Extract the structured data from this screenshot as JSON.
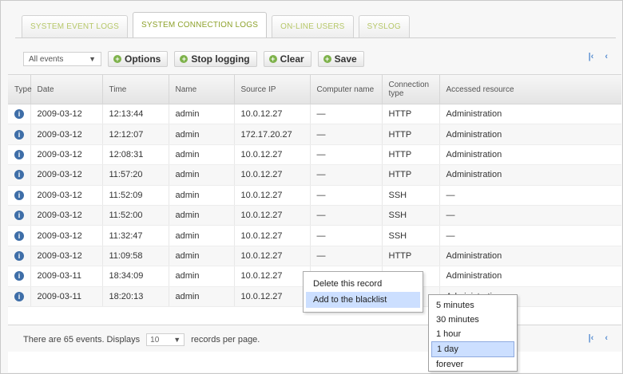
{
  "tabs": [
    {
      "label": "SYSTEM EVENT LOGS",
      "active": false
    },
    {
      "label": "SYSTEM CONNECTION LOGS",
      "active": true
    },
    {
      "label": "ON-LINE USERS",
      "active": false
    },
    {
      "label": "SYSLOG",
      "active": false
    }
  ],
  "toolbar": {
    "filter_value": "All events",
    "options_label": "Options",
    "stop_logging_label": "Stop logging",
    "clear_label": "Clear",
    "save_label": "Save"
  },
  "pager": {
    "first": "|‹",
    "prev": "‹"
  },
  "table": {
    "headers": [
      "Type",
      "Date",
      "Time",
      "Name",
      "Source IP",
      "Computer name",
      "Connection type",
      "Accessed resource"
    ],
    "rows": [
      [
        "i",
        "2009-03-12",
        "12:13:44",
        "admin",
        "10.0.12.27",
        "—",
        "HTTP",
        "Administration"
      ],
      [
        "i",
        "2009-03-12",
        "12:12:07",
        "admin",
        "172.17.20.27",
        "—",
        "HTTP",
        "Administration"
      ],
      [
        "i",
        "2009-03-12",
        "12:08:31",
        "admin",
        "10.0.12.27",
        "—",
        "HTTP",
        "Administration"
      ],
      [
        "i",
        "2009-03-12",
        "11:57:20",
        "admin",
        "10.0.12.27",
        "—",
        "HTTP",
        "Administration"
      ],
      [
        "i",
        "2009-03-12",
        "11:52:09",
        "admin",
        "10.0.12.27",
        "—",
        "SSH",
        "—"
      ],
      [
        "i",
        "2009-03-12",
        "11:52:00",
        "admin",
        "10.0.12.27",
        "—",
        "SSH",
        "—"
      ],
      [
        "i",
        "2009-03-12",
        "11:32:47",
        "admin",
        "10.0.12.27",
        "—",
        "SSH",
        "—"
      ],
      [
        "i",
        "2009-03-12",
        "11:09:58",
        "admin",
        "10.0.12.27",
        "—",
        "HTTP",
        "Administration"
      ],
      [
        "i",
        "2009-03-11",
        "18:34:09",
        "admin",
        "10.0.12.27",
        "—",
        "HTTP",
        "Administration"
      ],
      [
        "i",
        "2009-03-11",
        "18:20:13",
        "admin",
        "10.0.12.27",
        "—",
        "HTTP",
        "Administration"
      ]
    ]
  },
  "footer": {
    "prefix": "There are 65 events. Displays",
    "per_page_value": "10",
    "suffix": "records per page."
  },
  "context_menu": {
    "items": [
      "Delete this record",
      "Add to the blacklist"
    ]
  },
  "submenu": {
    "items": [
      "5 minutes",
      "30 minutes",
      "1 hour",
      "1 day",
      "forever"
    ]
  }
}
